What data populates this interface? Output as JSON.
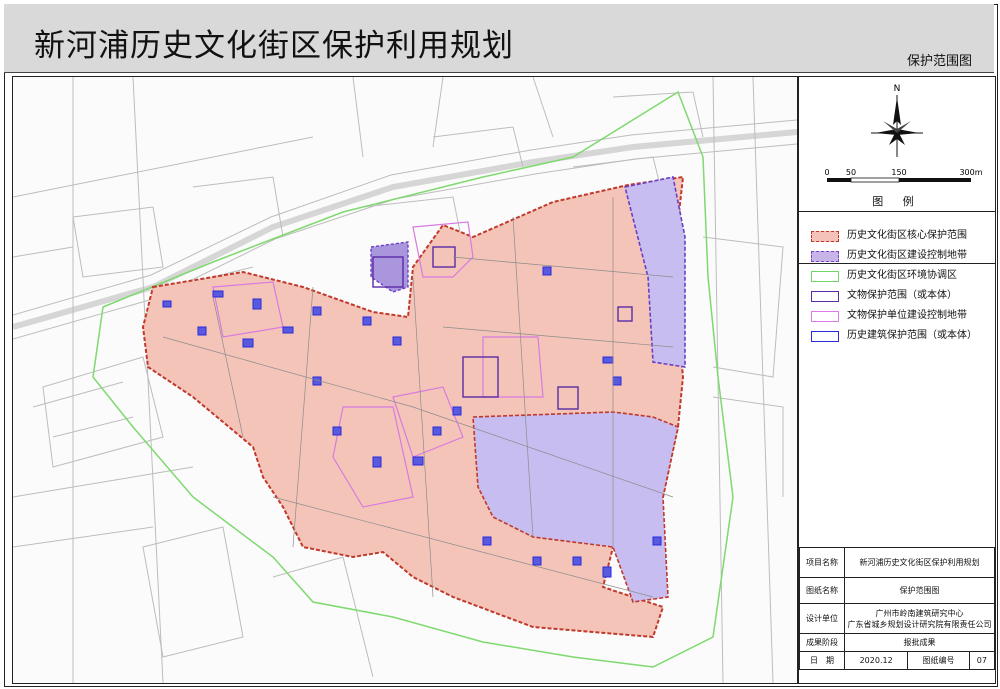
{
  "header": {
    "title": "新河浦历史文化街区保护利用规划",
    "subtitle": "保护范围图"
  },
  "compass": {
    "north_label": "N"
  },
  "scale_bar": {
    "ticks": [
      "0",
      "50",
      "150",
      "300m"
    ]
  },
  "legend": {
    "heading": "图  例",
    "items": [
      {
        "label": "历史文化街区核心保护范围",
        "fill": "#f4c2b8",
        "border": "#c0392b",
        "style": "dashed"
      },
      {
        "label": "历史文化街区建设控制地带",
        "fill": "#c7b5e8",
        "border": "#7b43c9",
        "style": "dashed"
      },
      {
        "label": "历史文化街区环境协调区",
        "fill": "none",
        "border": "#70d66a",
        "style": "solid"
      },
      {
        "label": "文物保护范围（或本体）",
        "fill": "none",
        "border": "#5b2aa8",
        "style": "solid"
      },
      {
        "label": "文物保护单位建设控制地带",
        "fill": "none",
        "border": "#e07ae6",
        "style": "solid"
      },
      {
        "label": "历史建筑保护范围（或本体）",
        "fill": "none",
        "border": "#2a2ad8",
        "style": "solid"
      }
    ]
  },
  "info": {
    "rows": [
      {
        "key": "项目名称",
        "value": "新河浦历史文化街区保护利用规划"
      },
      {
        "key": "图纸名称",
        "value": "保护范围图"
      },
      {
        "key": "设计单位",
        "value": "广州市岭南建筑研究中心",
        "value2": "广东省城乡规划设计研究院有限责任公司"
      },
      {
        "key": "成果阶段",
        "value": "报批成果"
      }
    ],
    "date_label": "日　期",
    "date_value": "2020.12",
    "number_label": "图纸编号",
    "number_value": "07"
  },
  "colors": {
    "core": "#f4c4b8",
    "core_border": "#c0392b",
    "control": "#c7bdf0",
    "control_border": "#6a3fc4",
    "env_border": "#7fd96f",
    "heritage": "#3a3ad6",
    "magenta": "#d77be0",
    "road": "#c9c9c9"
  }
}
